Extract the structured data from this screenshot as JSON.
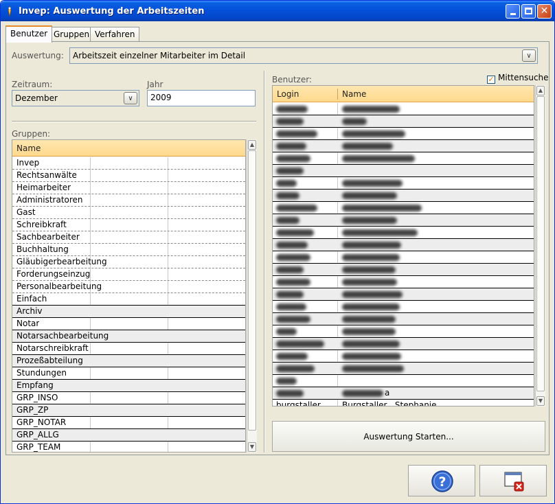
{
  "window": {
    "title": "Invep: Auswertung der Arbeitszeiten"
  },
  "tabs": [
    "Benutzer",
    "Gruppen",
    "Verfahren"
  ],
  "auswertung": {
    "label": "Auswertung:",
    "value": "Arbeitszeit einzelner Mitarbeiter im Detail"
  },
  "zeitraum": {
    "label": "Zeitraum:",
    "value": "Dezember"
  },
  "jahr": {
    "label": "Jahr",
    "value": "2009"
  },
  "gruppen": {
    "label": "Gruppen:",
    "header": "Name",
    "items": [
      "Invep",
      "Rechtsanwälte",
      "Heimarbeiter",
      "Administratoren",
      "Gast",
      "Schreibkraft",
      "Sachbearbeiter",
      "Buchhaltung",
      "Gläubigerbearbeitung",
      "Forderungseinzug",
      "Personalbearbeitung",
      "Einfach",
      "Archiv",
      "Notar",
      "Notarsachbearbeitung",
      "Notarschreibkraft",
      "Prozeßabteilung",
      "Stundungen",
      "Empfang",
      "GRP_INSO",
      "GRP_ZP",
      "GRP_NOTAR",
      "GRP_ALLG",
      "GRP_TEAM"
    ]
  },
  "benutzer": {
    "label": "Benutzer:",
    "mittensuche": "Mittensuche",
    "header_login": "Login",
    "header_name": "Name",
    "rows": [
      {
        "login": "",
        "name": ""
      },
      {
        "login": "",
        "name": ""
      },
      {
        "login": "",
        "name": ""
      },
      {
        "login": "",
        "name": ""
      },
      {
        "login": "",
        "name": ""
      },
      {
        "login": "",
        "name": ""
      },
      {
        "login": "",
        "name": ""
      },
      {
        "login": "",
        "name": ""
      },
      {
        "login": "",
        "name": ""
      },
      {
        "login": "",
        "name": ""
      },
      {
        "login": "",
        "name": ""
      },
      {
        "login": "",
        "name": ""
      },
      {
        "login": "",
        "name": ""
      },
      {
        "login": "",
        "name": ""
      },
      {
        "login": "",
        "name": ""
      },
      {
        "login": "",
        "name": ""
      },
      {
        "login": "",
        "name": ""
      },
      {
        "login": "",
        "name": ""
      },
      {
        "login": "",
        "name": ""
      },
      {
        "login": "",
        "name": ""
      },
      {
        "login": "",
        "name": ""
      },
      {
        "login": "",
        "name": ""
      },
      {
        "login": "",
        "name": ""
      },
      {
        "login": "",
        "name": "a"
      },
      {
        "login": "burgstaller",
        "name": "Burgstaller , Stephanie"
      }
    ]
  },
  "start_button": "Auswertung Starten...",
  "icons": {
    "help": "help-icon",
    "close": "close-window-icon"
  }
}
